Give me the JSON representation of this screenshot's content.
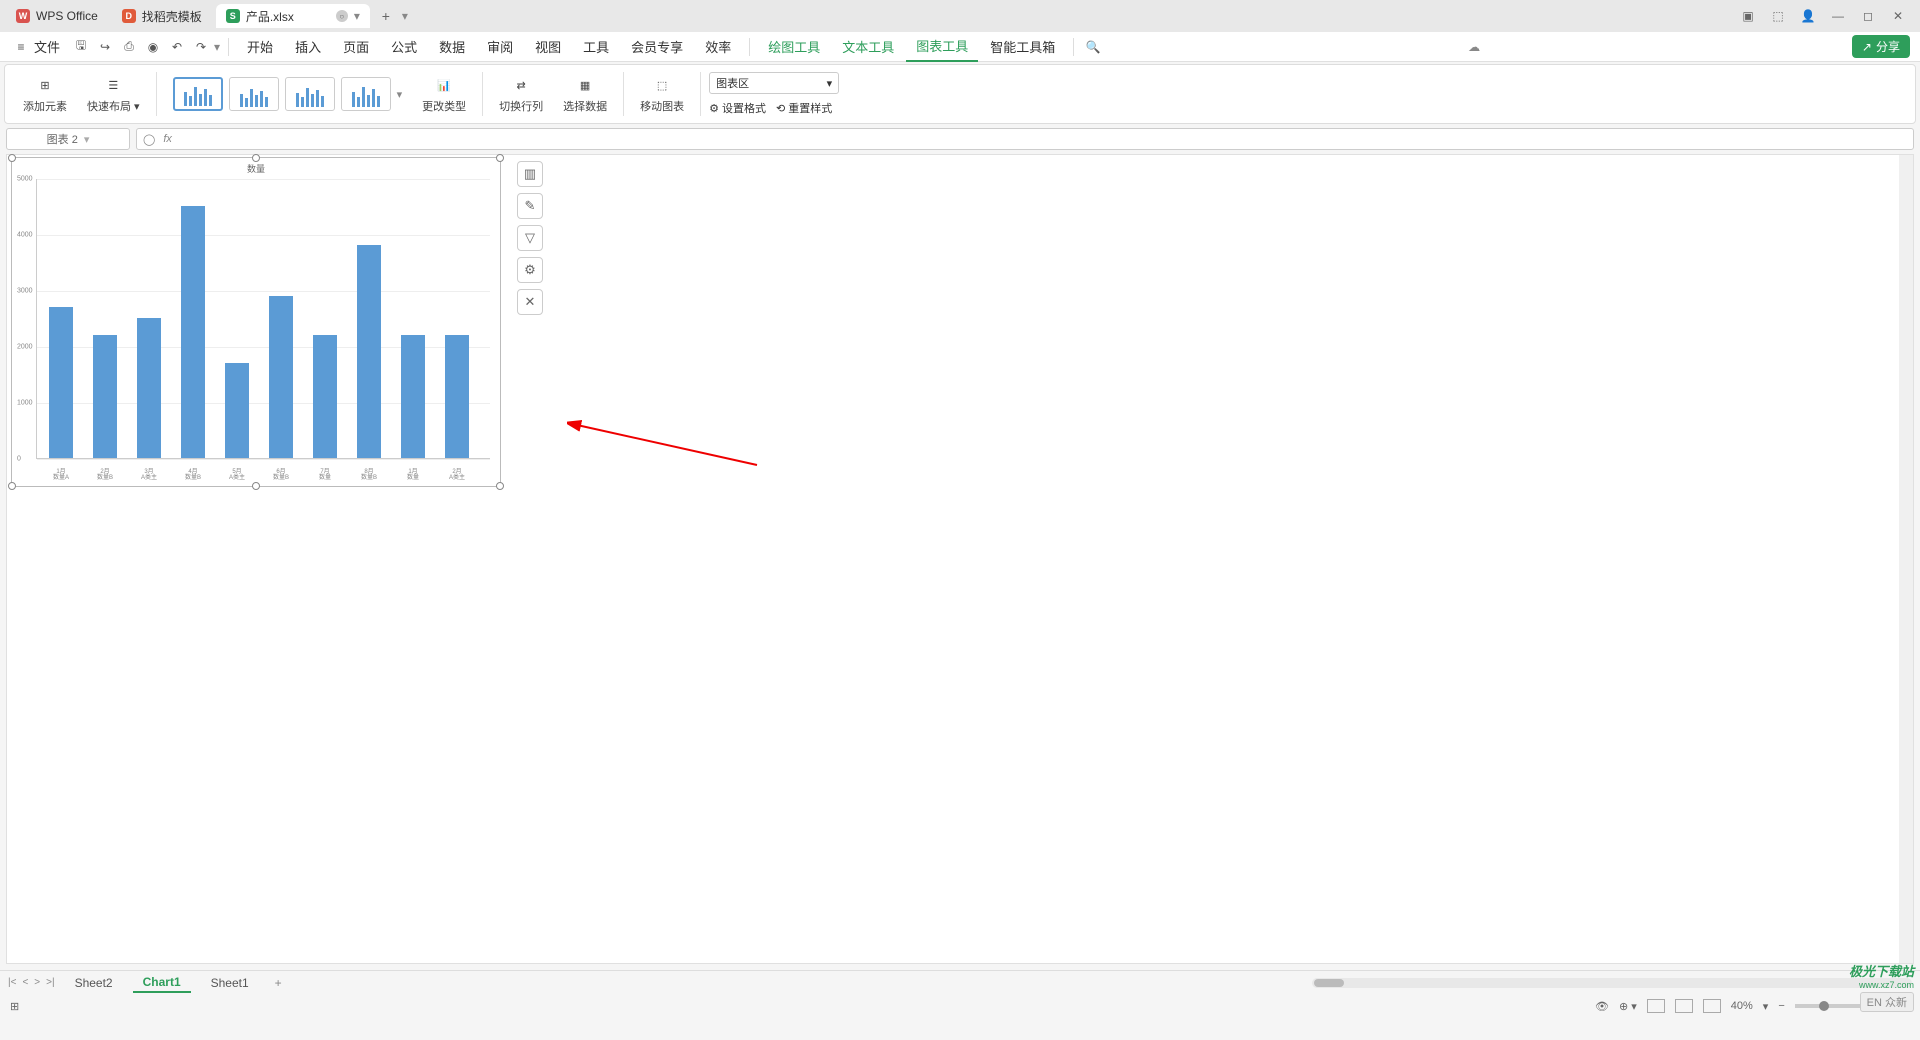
{
  "titlebar": {
    "tabs": [
      {
        "icon": "W",
        "label": "WPS Office"
      },
      {
        "icon": "D",
        "label": "找稻壳模板"
      },
      {
        "icon": "S",
        "label": "产品.xlsx"
      }
    ],
    "new_tab": "+"
  },
  "menubar": {
    "file": "文件",
    "items": [
      "开始",
      "插入",
      "页面",
      "公式",
      "数据",
      "审阅",
      "视图",
      "工具",
      "会员专享",
      "效率",
      "绘图工具",
      "文本工具",
      "图表工具",
      "智能工具箱"
    ],
    "green_indices": [
      10,
      11,
      12
    ],
    "active_index": 12,
    "share": "分享"
  },
  "ribbon": {
    "add_element": "添加元素",
    "quick_layout": "快速布局",
    "change_type": "更改类型",
    "switch_rowcol": "切换行列",
    "select_data": "选择数据",
    "move_chart": "移动图表",
    "chart_area_label": "图表区",
    "set_format": "设置格式",
    "reset_style": "重置样式"
  },
  "formula": {
    "name_box": "图表 2",
    "fx": "fx"
  },
  "chart_tools": [
    "chart-type-icon",
    "brush-icon",
    "filter-icon",
    "gear-icon",
    "tools-icon"
  ],
  "sheets": {
    "items": [
      "Sheet2",
      "Chart1",
      "Sheet1"
    ],
    "active": 1,
    "add": "+"
  },
  "statusbar": {
    "zoom": "40%",
    "lang": "EN"
  },
  "watermark": {
    "brand": "极光下载站",
    "url": "www.xz7.com",
    "pill": "众新"
  },
  "chart_data": {
    "type": "bar",
    "title": "数量",
    "categories": [
      "1月 数量A",
      "2月 数量B",
      "3月 A类主",
      "4月 数量B",
      "5月 A类主",
      "6月 数量B",
      "7月 数量",
      "8月 数量B",
      "1月 数量",
      "2月 A类主"
    ],
    "values": [
      2700,
      2200,
      2500,
      4500,
      1700,
      2900,
      2200,
      3800,
      2200,
      2200
    ],
    "ylim": [
      0,
      5000
    ],
    "yticks": [
      0,
      1000,
      2000,
      3000,
      4000,
      5000
    ],
    "color": "#5b9bd5"
  }
}
